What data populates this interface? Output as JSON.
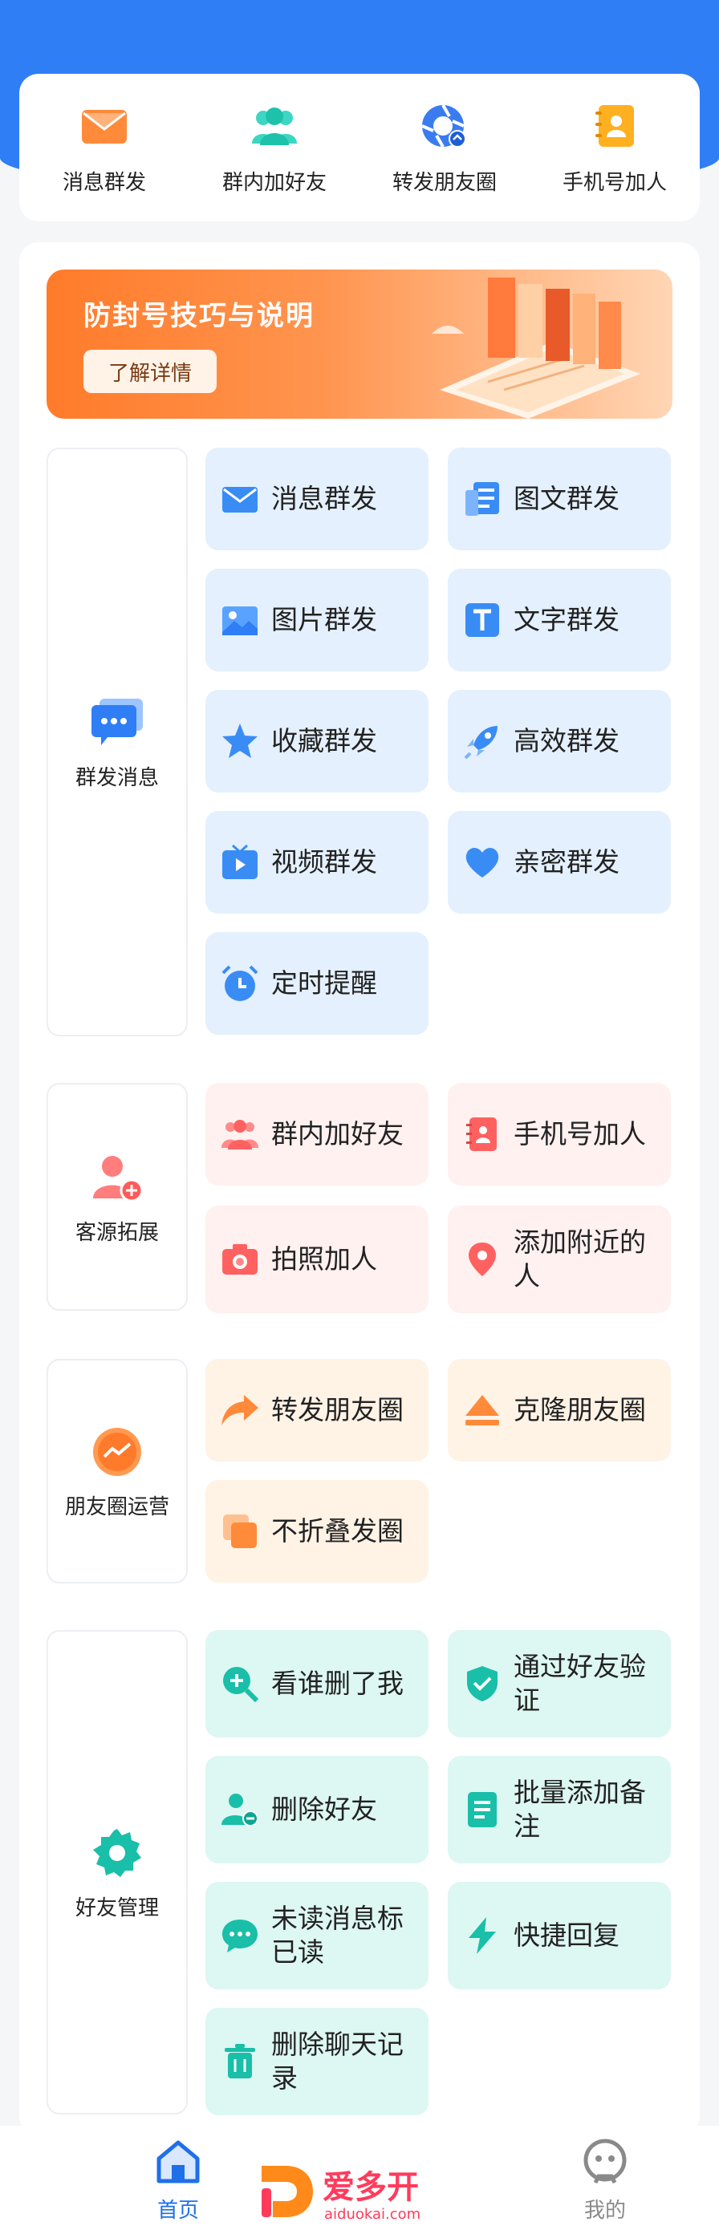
{
  "colors": {
    "brand_blue": "#2f7ef5",
    "banner_orange": "#ff7b2a",
    "tile_blue": "#e4f0fd",
    "tile_pink": "#fff1f0",
    "tile_orange": "#fff3e6",
    "tile_teal": "#ddf7f2",
    "nav_active": "#1f6fe8"
  },
  "quick": [
    {
      "label": "消息群发",
      "icon": "envelope-icon"
    },
    {
      "label": "群内加好友",
      "icon": "group-icon"
    },
    {
      "label": "转发朋友圈",
      "icon": "camera-shutter-icon"
    },
    {
      "label": "手机号加人",
      "icon": "contact-book-icon"
    }
  ],
  "banner": {
    "title": "防封号技巧与说明",
    "button": "了解详情"
  },
  "sections": {
    "mass_message": {
      "label": "群发消息",
      "items": [
        "消息群发",
        "图文群发",
        "图片群发",
        "文字群发",
        "收藏群发",
        "高效群发",
        "视频群发",
        "亲密群发",
        "定时提醒"
      ]
    },
    "customer": {
      "label": "客源拓展",
      "items": [
        "群内加好友",
        "手机号加人",
        "拍照加人",
        "添加附近的人"
      ]
    },
    "moments": {
      "label": "朋友圈运营",
      "items": [
        "转发朋友圈",
        "克隆朋友圈",
        "不折叠发圈"
      ]
    },
    "friends": {
      "label": "好友管理",
      "items": [
        "看谁删了我",
        "通过好友验证",
        "删除好友",
        "批量添加备注",
        "未读消息标已读",
        "快捷回复",
        "删除聊天记录"
      ]
    }
  },
  "nav": {
    "home": "首页",
    "me": "我的",
    "logo_text": "爱多开",
    "logo_url": "aiduokai.com"
  }
}
